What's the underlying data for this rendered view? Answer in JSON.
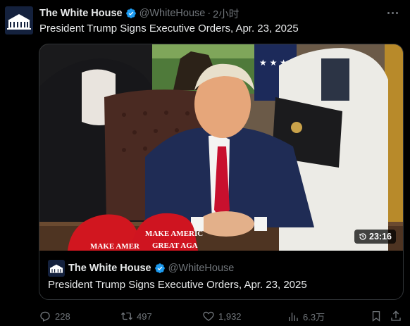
{
  "author": {
    "name": "The White House",
    "handle": "@WhiteHouse",
    "separator": "·",
    "time": "2小时"
  },
  "tweet": {
    "text": "President Trump Signs Executive Orders, Apr. 23, 2025"
  },
  "quoted": {
    "name": "The White House",
    "handle": "@WhiteHouse",
    "text": "President Trump Signs Executive Orders, Apr. 23, 2025",
    "video_duration": "23:16",
    "hat_text_1": "MAKE AMER",
    "hat_text_2": "MAKE AMERIC",
    "hat_text_3": "GREAT AGA"
  },
  "actions": {
    "replies": "228",
    "reposts": "497",
    "likes": "1,932",
    "views": "6.3万"
  },
  "colors": {
    "background": "#000000",
    "text_primary": "#e7e9ea",
    "text_secondary": "#71767b",
    "verified": "#1d9bf0",
    "border": "#2f3336"
  }
}
